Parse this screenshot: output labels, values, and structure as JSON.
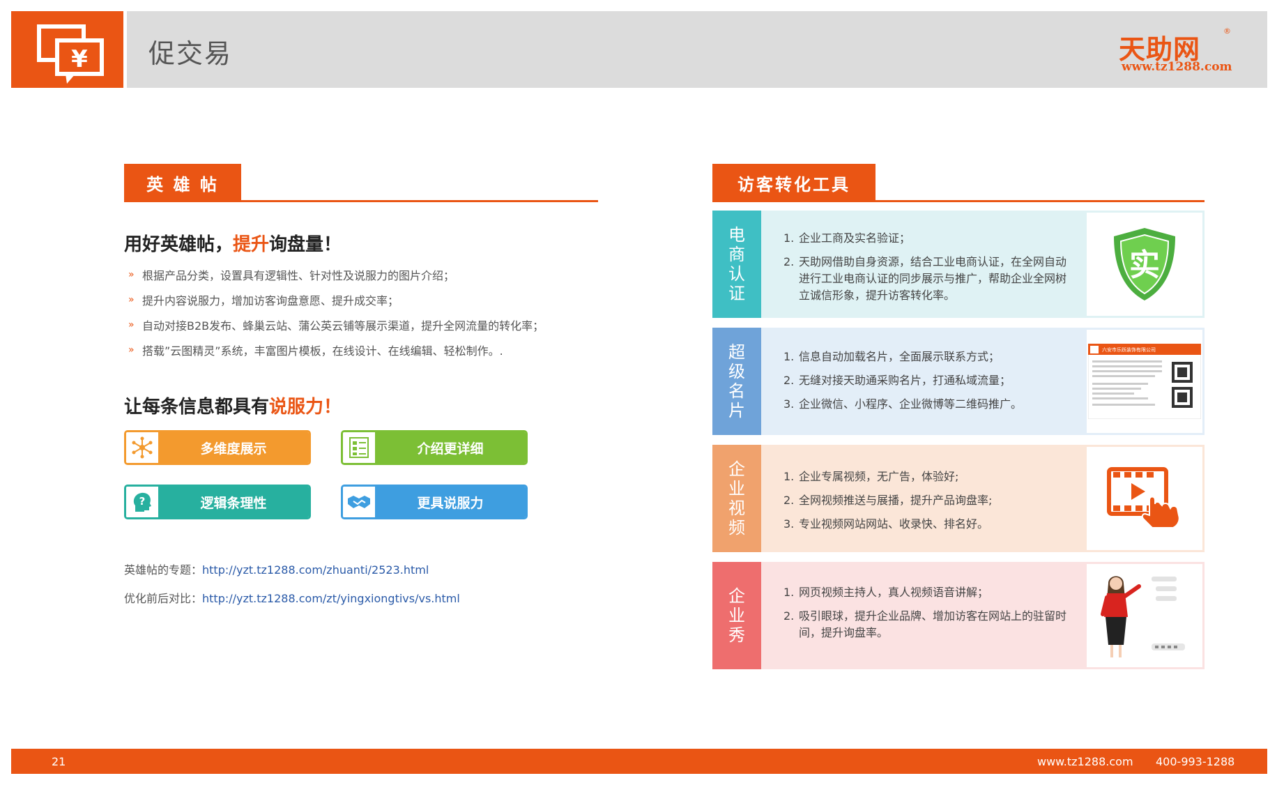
{
  "header": {
    "title": "促交易",
    "logo": {
      "name": "天助网",
      "reg_mark": "®",
      "url": "www.tz1288.com"
    }
  },
  "left": {
    "section_title": "英 雄 帖",
    "heading1": {
      "prefix": "用好英雄帖，",
      "highlight": "提升",
      "suffix": "询盘量！"
    },
    "bullets": [
      "根据产品分类，设置具有逻辑性、针对性及说服力的图片介绍；",
      "提升内容说服力，增加访客询盘意愿、提升成交率；",
      "自动对接B2B发布、蜂巢云站、蒲公英云铺等展示渠道，提升全网流量的转化率；",
      "搭载”云图精灵”系统，丰富图片模板，在线设计、在线编辑、轻松制作。."
    ],
    "bullet_mark": "»",
    "heading2": {
      "prefix": "让每条信息都具有",
      "highlight": "说服力！"
    },
    "features": [
      {
        "label": "多维度展示",
        "icon": "network-icon",
        "color": "#f39a2e"
      },
      {
        "label": "介绍更详细",
        "icon": "document-list-icon",
        "color": "#7cbf35"
      },
      {
        "label": "逻辑条理性",
        "icon": "head-question-icon",
        "color": "#27b09f"
      },
      {
        "label": "更具说服力",
        "icon": "handshake-icon",
        "color": "#3e9ee0"
      }
    ],
    "links": [
      {
        "label": "英雄帖的专题：",
        "url": "http://yzt.tz1288.com/zhuanti/2523.html"
      },
      {
        "label": "优化前后对比：",
        "url": "http://yzt.tz1288.com/zt/yingxiongtivs/vs.html"
      }
    ]
  },
  "right": {
    "section_title": "访客转化工具",
    "cards": [
      {
        "label": [
          "电",
          "商",
          "认",
          "证"
        ],
        "color": "#3fbfc4",
        "bg": "#dff2f4",
        "image": "shield-verified-icon",
        "badge_char": "实",
        "items": [
          {
            "n": "1.",
            "text": "企业工商及实名验证；"
          },
          {
            "n": "2.",
            "text": "天助网借助自身资源，结合工业电商认证，在全网自动进行工业电商认证的同步展示与推广，帮助企业全网树立诚信形象，提升访客转化率。"
          }
        ]
      },
      {
        "label": [
          "超",
          "级",
          "名",
          "片"
        ],
        "color": "#6fa3d9",
        "bg": "#e3eef8",
        "image": "business-card-thumbnail",
        "card_company": "六安市乐跃装饰有限公司",
        "items": [
          {
            "n": "1.",
            "text": "信息自动加载名片，全面展示联系方式；"
          },
          {
            "n": "2.",
            "text": "无缝对接天助通采购名片，打通私域流量；"
          },
          {
            "n": "3.",
            "text": "企业微信、小程序、企业微博等二维码推广。"
          }
        ]
      },
      {
        "label": [
          "企",
          "业",
          "视",
          "频"
        ],
        "color": "#f0a26d",
        "bg": "#fbe6d8",
        "image": "video-play-hand-icon",
        "items": [
          {
            "n": "1.",
            "text": "企业专属视频，无广告，体验好;"
          },
          {
            "n": "2.",
            "text": "全网视频推送与展播，提升产品询盘率;"
          },
          {
            "n": "3.",
            "text": "专业视频网站网站、收录快、排名好。"
          }
        ]
      },
      {
        "label": [
          "企",
          "业",
          "秀"
        ],
        "color": "#ee6e6e",
        "bg": "#fbe2e2",
        "image": "presenter-woman-illustration",
        "items": [
          {
            "n": "1.",
            "text": "网页视频主持人，真人视频语音讲解；"
          },
          {
            "n": "2.",
            "text": "吸引眼球，提升企业品牌、增加访客在网站上的驻留时间，提升询盘率。"
          }
        ]
      }
    ]
  },
  "footer": {
    "page": "21",
    "site": "www.tz1288.com",
    "phone": "400-993-1288"
  }
}
